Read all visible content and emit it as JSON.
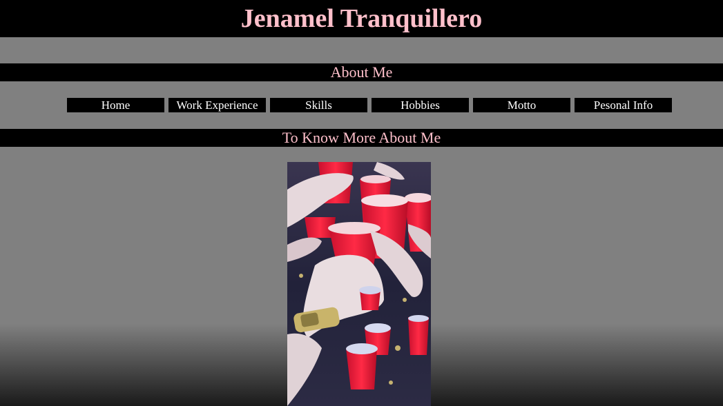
{
  "header": {
    "title": "Jenamel Tranquillero"
  },
  "sections": {
    "about": "About Me",
    "more": "To Know More About Me"
  },
  "nav": {
    "items": [
      "Home",
      "Work Experience",
      "Skills",
      "Hobbies",
      "Motto",
      "Pesonal Info"
    ]
  },
  "colors": {
    "heading": "#ffc0cb",
    "bar": "#000000",
    "page": "#808080",
    "nav_text": "#ffffff"
  }
}
